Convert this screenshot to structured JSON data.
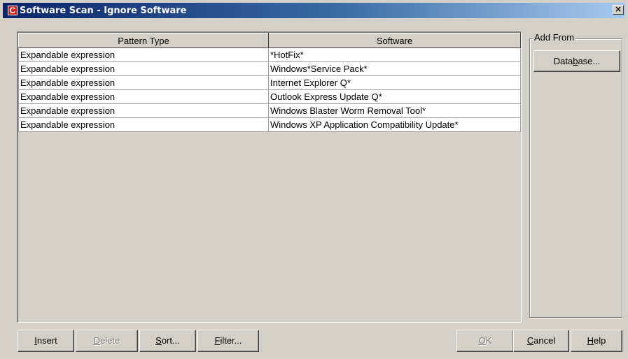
{
  "window": {
    "icon_glyph": "C",
    "title": "Software Scan - Ignore Software",
    "close_glyph": "×"
  },
  "table": {
    "headers": [
      "Pattern Type",
      "Software"
    ],
    "rows": [
      [
        "Expandable expression",
        "*HotFix*"
      ],
      [
        "Expandable expression",
        "Windows*Service Pack*"
      ],
      [
        "Expandable expression",
        "Internet Explorer Q*"
      ],
      [
        "Expandable expression",
        "Outlook Express Update Q*"
      ],
      [
        "Expandable expression",
        "Windows Blaster Worm Removal Tool*"
      ],
      [
        "Expandable expression",
        "Windows XP Application Compatibility Update*"
      ]
    ]
  },
  "add_from": {
    "legend": "Add From",
    "database_pre": "Data",
    "database_key": "b",
    "database_post": "ase..."
  },
  "buttons": {
    "insert": {
      "key": "I",
      "rest": "nsert",
      "enabled": true
    },
    "delete": {
      "key": "D",
      "rest": "elete",
      "enabled": false
    },
    "sort": {
      "key": "S",
      "rest": "ort...",
      "enabled": true
    },
    "filter": {
      "key": "F",
      "rest": "ilter...",
      "enabled": true
    },
    "ok": {
      "key": "O",
      "rest": "K",
      "enabled": false
    },
    "cancel": {
      "key": "C",
      "rest": "ancel",
      "enabled": true
    },
    "help": {
      "key": "H",
      "rest": "elp",
      "enabled": true
    }
  }
}
